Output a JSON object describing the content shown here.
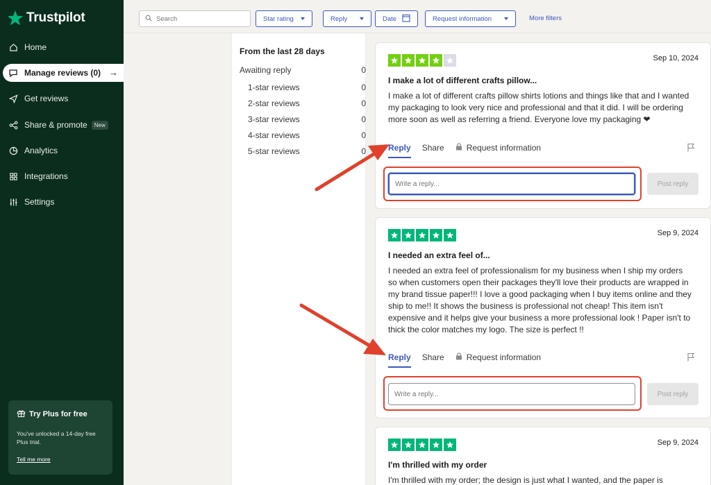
{
  "brand": {
    "name": "Trustpilot",
    "accent": "#3c57bc",
    "sidebar_bg": "#0b2d1e",
    "star_green": "#00b67a"
  },
  "sidebar": {
    "items": [
      {
        "label": "Home",
        "icon": "home-icon"
      },
      {
        "label": "Manage reviews (0)",
        "icon": "chat-bubble-icon",
        "active": true
      },
      {
        "label": "Get reviews",
        "icon": "send-icon"
      },
      {
        "label": "Share & promote",
        "icon": "share-icon",
        "badge": "New"
      },
      {
        "label": "Analytics",
        "icon": "pie-chart-icon"
      },
      {
        "label": "Integrations",
        "icon": "grid-icon"
      },
      {
        "label": "Settings",
        "icon": "sliders-icon"
      }
    ],
    "promo": {
      "title": "Try Plus for free",
      "text": "You've unlocked a 14-day free Plus trial.",
      "link": "Tell me more"
    }
  },
  "filters": {
    "search_placeholder": "Search",
    "star_rating": "Star rating",
    "reply": "Reply",
    "date": "Date",
    "request_information": "Request information",
    "more_filters": "More filters"
  },
  "stats": {
    "title": "From the last 28 days",
    "awaiting_label": "Awaiting reply",
    "awaiting_value": "0",
    "rows": [
      {
        "label": "1-star reviews",
        "value": "0"
      },
      {
        "label": "2-star reviews",
        "value": "0"
      },
      {
        "label": "3-star reviews",
        "value": "0"
      },
      {
        "label": "4-star reviews",
        "value": "0"
      },
      {
        "label": "5-star reviews",
        "value": "0"
      }
    ]
  },
  "reviews": [
    {
      "rating": 4,
      "date": "Sep 10, 2024",
      "title": "I make a lot of different crafts pillow...",
      "body": "I make a lot of different crafts pillow shirts lotions and things like that and I wanted my packaging to look very nice and professional and that it did. I will be ordering more soon as well as referring a friend. Everyone love my packaging ❤"
    },
    {
      "rating": 5,
      "date": "Sep 9, 2024",
      "title": "I needed an extra feel of...",
      "body": "I needed an extra feel of professionalism for my business when I ship my orders so when customers open their packages they'll love their products are wrapped in my brand tissue paper!!! I love a good packaging when I buy items online and they ship to me!! It shows the business is professional not cheap! This item isn't expensive and it helps give your business a more professional look ! Paper isn't to thick the color matches my logo. The size is perfect !!"
    },
    {
      "rating": 5,
      "date": "Sep 9, 2024",
      "title": "I'm thrilled with my order",
      "body": "I'm thrilled with my order; the design is just what I wanted, and the paper is"
    }
  ],
  "review_actions": {
    "reply_tab": "Reply",
    "share_tab": "Share",
    "request_info_tab": "Request information",
    "reply_placeholder": "Write a reply...",
    "post_reply": "Post reply"
  },
  "annotation_color": "#e0412c"
}
